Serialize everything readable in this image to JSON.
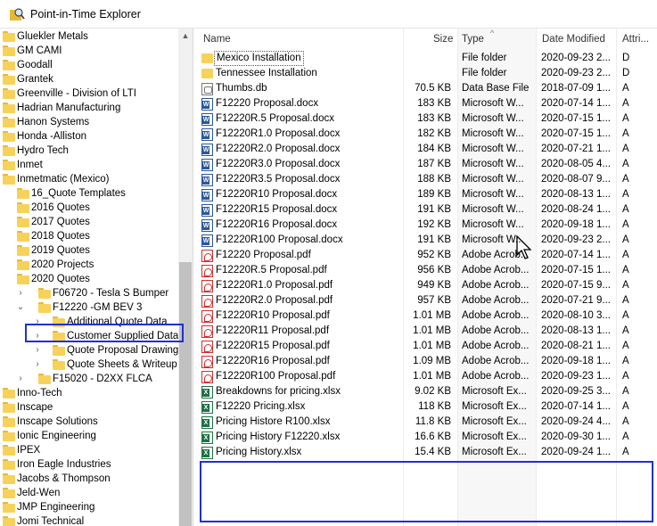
{
  "window": {
    "title": "Point-in-Time Explorer",
    "icon": "magnifier-folder-icon"
  },
  "tree": {
    "items": [
      {
        "label": "Gluekler Metals",
        "level": 0,
        "expander": ""
      },
      {
        "label": "GM CAMI",
        "level": 0,
        "expander": ""
      },
      {
        "label": "Goodall",
        "level": 0,
        "expander": ""
      },
      {
        "label": "Grantek",
        "level": 0,
        "expander": ""
      },
      {
        "label": "Greenville - Division of LTI",
        "level": 0,
        "expander": ""
      },
      {
        "label": "Hadrian Manufacturing",
        "level": 0,
        "expander": ""
      },
      {
        "label": "Hanon Systems",
        "level": 0,
        "expander": ""
      },
      {
        "label": "Honda -Alliston",
        "level": 0,
        "expander": ""
      },
      {
        "label": "Hydro Tech",
        "level": 0,
        "expander": ""
      },
      {
        "label": "Inmet",
        "level": 0,
        "expander": ""
      },
      {
        "label": "Inmetmatic (Mexico)",
        "level": 0,
        "expander": ""
      },
      {
        "label": "16_Quote Templates",
        "level": 1,
        "expander": ""
      },
      {
        "label": "2016 Quotes",
        "level": 1,
        "expander": ""
      },
      {
        "label": "2017 Quotes",
        "level": 1,
        "expander": ""
      },
      {
        "label": "2018 Quotes",
        "level": 1,
        "expander": ""
      },
      {
        "label": "2019 Quotes",
        "level": 1,
        "expander": ""
      },
      {
        "label": "2020 Projects",
        "level": 1,
        "expander": ""
      },
      {
        "label": "2020 Quotes",
        "level": 1,
        "expander": ""
      },
      {
        "label": "F06720 - Tesla S Bumper",
        "level": 2,
        "expander": "›"
      },
      {
        "label": "F12220 -GM BEV 3",
        "level": 2,
        "expander": "⌄"
      },
      {
        "label": "Additional Quote Data",
        "level": 3,
        "expander": "›"
      },
      {
        "label": "Customer Supplied Data",
        "level": 3,
        "expander": "›"
      },
      {
        "label": "Quote Proposal Drawings",
        "level": 3,
        "expander": "›"
      },
      {
        "label": "Quote Sheets & Writeup",
        "level": 3,
        "expander": "›"
      },
      {
        "label": "F15020 - D2XX FLCA",
        "level": 2,
        "expander": "›"
      },
      {
        "label": "Inno-Tech",
        "level": 0,
        "expander": ""
      },
      {
        "label": "Inscape",
        "level": 0,
        "expander": ""
      },
      {
        "label": "Inscape Solutions",
        "level": 0,
        "expander": ""
      },
      {
        "label": "Ionic Engineering",
        "level": 0,
        "expander": ""
      },
      {
        "label": "IPEX",
        "level": 0,
        "expander": ""
      },
      {
        "label": "Iron Eagle Industries",
        "level": 0,
        "expander": ""
      },
      {
        "label": "Jacobs & Thompson",
        "level": 0,
        "expander": ""
      },
      {
        "label": "Jeld-Wen",
        "level": 0,
        "expander": ""
      },
      {
        "label": "JMP Engineering",
        "level": 0,
        "expander": ""
      },
      {
        "label": "Jomi Technical",
        "level": 0,
        "expander": ""
      }
    ]
  },
  "list": {
    "columns": {
      "name": "Name",
      "size": "Size",
      "type": "Type",
      "modified": "Date Modified",
      "attr": "Attri..."
    },
    "rows": [
      {
        "icon": "folder",
        "name": "Mexico Installation",
        "size": "",
        "type": "File folder",
        "modified": "2020-09-23 2...",
        "attr": "D"
      },
      {
        "icon": "folder",
        "name": "Tennessee Installation",
        "size": "",
        "type": "File folder",
        "modified": "2020-09-23 2...",
        "attr": "D"
      },
      {
        "icon": "db",
        "name": "Thumbs.db",
        "size": "70.5 KB",
        "type": "Data Base File",
        "modified": "2018-07-09 1...",
        "attr": "A"
      },
      {
        "icon": "word",
        "name": "F12220 Proposal.docx",
        "size": "183 KB",
        "type": "Microsoft W...",
        "modified": "2020-07-14 1...",
        "attr": "A"
      },
      {
        "icon": "word",
        "name": "F12220R.5 Proposal.docx",
        "size": "183 KB",
        "type": "Microsoft W...",
        "modified": "2020-07-15 1...",
        "attr": "A"
      },
      {
        "icon": "word",
        "name": "F12220R1.0 Proposal.docx",
        "size": "182 KB",
        "type": "Microsoft W...",
        "modified": "2020-07-15 1...",
        "attr": "A"
      },
      {
        "icon": "word",
        "name": "F12220R2.0 Proposal.docx",
        "size": "184 KB",
        "type": "Microsoft W...",
        "modified": "2020-07-21 1...",
        "attr": "A"
      },
      {
        "icon": "word",
        "name": "F12220R3.0 Proposal.docx",
        "size": "187 KB",
        "type": "Microsoft W...",
        "modified": "2020-08-05 4...",
        "attr": "A"
      },
      {
        "icon": "word",
        "name": "F12220R3.5 Proposal.docx",
        "size": "188 KB",
        "type": "Microsoft W...",
        "modified": "2020-08-07 9...",
        "attr": "A"
      },
      {
        "icon": "word",
        "name": "F12220R10 Proposal.docx",
        "size": "189 KB",
        "type": "Microsoft W...",
        "modified": "2020-08-13 1...",
        "attr": "A"
      },
      {
        "icon": "word",
        "name": "F12220R15 Proposal.docx",
        "size": "191 KB",
        "type": "Microsoft W...",
        "modified": "2020-08-24 1...",
        "attr": "A"
      },
      {
        "icon": "word",
        "name": "F12220R16 Proposal.docx",
        "size": "192 KB",
        "type": "Microsoft W...",
        "modified": "2020-09-18 1...",
        "attr": "A"
      },
      {
        "icon": "word",
        "name": "F12220R100 Proposal.docx",
        "size": "191 KB",
        "type": "Microsoft W...",
        "modified": "2020-09-23 2...",
        "attr": "A"
      },
      {
        "icon": "pdf",
        "name": "F12220 Proposal.pdf",
        "size": "952 KB",
        "type": "Adobe Acrob...",
        "modified": "2020-07-14 1...",
        "attr": "A"
      },
      {
        "icon": "pdf",
        "name": "F12220R.5 Proposal.pdf",
        "size": "956 KB",
        "type": "Adobe Acrob...",
        "modified": "2020-07-15 1...",
        "attr": "A"
      },
      {
        "icon": "pdf",
        "name": "F12220R1.0 Proposal.pdf",
        "size": "949 KB",
        "type": "Adobe Acrob...",
        "modified": "2020-07-15 9...",
        "attr": "A"
      },
      {
        "icon": "pdf",
        "name": "F12220R2.0 Proposal.pdf",
        "size": "957 KB",
        "type": "Adobe Acrob...",
        "modified": "2020-07-21 9...",
        "attr": "A"
      },
      {
        "icon": "pdf",
        "name": "F12220R10 Proposal.pdf",
        "size": "1.01 MB",
        "type": "Adobe Acrob...",
        "modified": "2020-08-10 3...",
        "attr": "A"
      },
      {
        "icon": "pdf",
        "name": "F12220R11 Proposal.pdf",
        "size": "1.01 MB",
        "type": "Adobe Acrob...",
        "modified": "2020-08-13 1...",
        "attr": "A"
      },
      {
        "icon": "pdf",
        "name": "F12220R15 Proposal.pdf",
        "size": "1.01 MB",
        "type": "Adobe Acrob...",
        "modified": "2020-08-21 1...",
        "attr": "A"
      },
      {
        "icon": "pdf",
        "name": "F12220R16 Proposal.pdf",
        "size": "1.09 MB",
        "type": "Adobe Acrob...",
        "modified": "2020-09-18 1...",
        "attr": "A"
      },
      {
        "icon": "pdf",
        "name": "F12220R100 Proposal.pdf",
        "size": "1.01 MB",
        "type": "Adobe Acrob...",
        "modified": "2020-09-23 1...",
        "attr": "A"
      },
      {
        "icon": "xls",
        "name": "Breakdowns for pricing.xlsx",
        "size": "9.02 KB",
        "type": "Microsoft Ex...",
        "modified": "2020-09-25 3...",
        "attr": "A"
      },
      {
        "icon": "xls",
        "name": "F12220 Pricing.xlsx",
        "size": "118 KB",
        "type": "Microsoft Ex...",
        "modified": "2020-07-14 1...",
        "attr": "A"
      },
      {
        "icon": "xls",
        "name": "Pricing Histore R100.xlsx",
        "size": "11.8 KB",
        "type": "Microsoft Ex...",
        "modified": "2020-09-24 4...",
        "attr": "A"
      },
      {
        "icon": "xls",
        "name": "Pricing History F12220.xlsx",
        "size": "16.6 KB",
        "type": "Microsoft Ex...",
        "modified": "2020-09-30 1...",
        "attr": "A"
      },
      {
        "icon": "xls",
        "name": "Pricing History.xlsx",
        "size": "15.4 KB",
        "type": "Microsoft Ex...",
        "modified": "2020-09-24 1...",
        "attr": "A"
      }
    ]
  },
  "colors": {
    "highlight": "#1f2fd6",
    "folder": "#f7d25b",
    "word": "#2b579a",
    "pdf": "#d32f2f",
    "excel": "#1e7145"
  }
}
